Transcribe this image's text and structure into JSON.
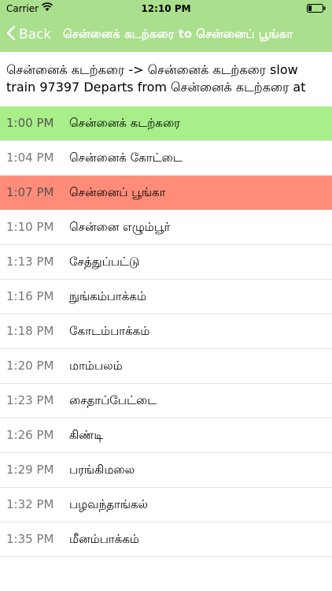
{
  "status": {
    "carrier": "Carrier",
    "time": "12:10 PM"
  },
  "nav": {
    "back_label": "Back",
    "title": "சென்னைக் கடற்கரை to சென்னைப் பூங்கா"
  },
  "header": {
    "line1": "சென்னைக் கடற்கரை -> சென்னைக் கடற்கரை slow",
    "line2": "train 97397 Departs from சென்னைக் கடற்கரை at"
  },
  "colors": {
    "bar": "#a9df8d",
    "start_row": "#a8ef89",
    "end_row": "#ff8c78"
  },
  "rows": [
    {
      "time": "1:00 PM",
      "station": "சென்னைக் கடற்கரை"
    },
    {
      "time": "1:04 PM",
      "station": "சென்னைக் கோட்டை"
    },
    {
      "time": "1:07 PM",
      "station": "சென்னைப் பூங்கா"
    },
    {
      "time": "1:10 PM",
      "station": "சென்னை எழும்பூர்"
    },
    {
      "time": "1:13 PM",
      "station": "சேத்துப்பட்டு"
    },
    {
      "time": "1:16 PM",
      "station": "நுங்கம்பாக்கம்"
    },
    {
      "time": "1:18 PM",
      "station": "கோடம்பாக்கம்"
    },
    {
      "time": "1:20 PM",
      "station": "மாம்பலம்"
    },
    {
      "time": "1:23 PM",
      "station": "சைதாப்பேட்டை"
    },
    {
      "time": "1:26 PM",
      "station": "கிண்டி"
    },
    {
      "time": "1:29 PM",
      "station": "பரங்கிமலை"
    },
    {
      "time": "1:32 PM",
      "station": "பழவந்தாங்கல்"
    },
    {
      "time": "1:35 PM",
      "station": "மீனம்பாக்கம்"
    }
  ]
}
